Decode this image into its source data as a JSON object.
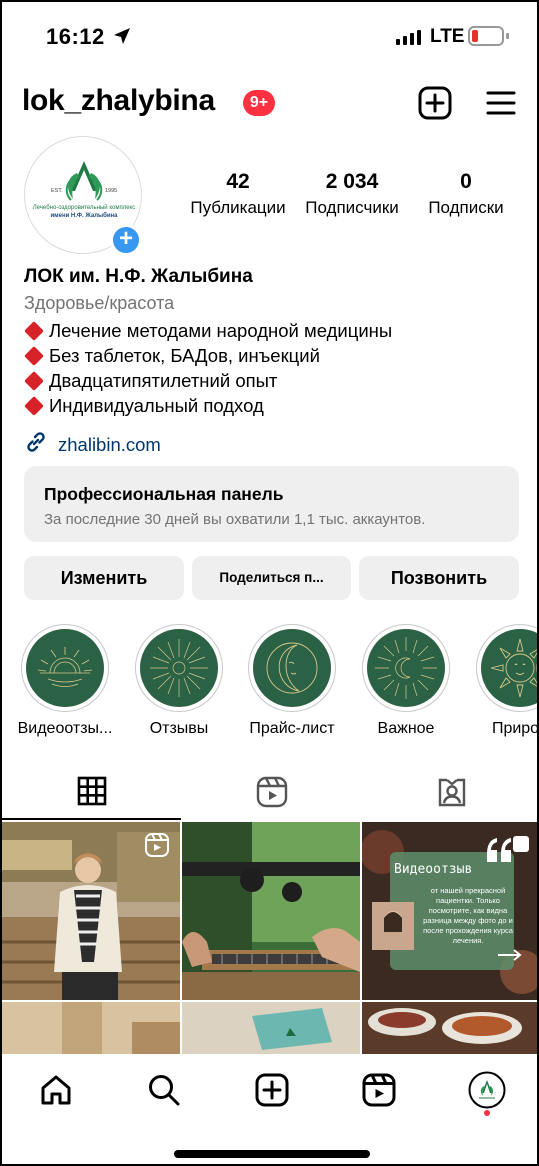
{
  "status_bar": {
    "time": "16:12",
    "network": "LTE",
    "location_icon": "location-arrow-icon",
    "signal_icon": "signal-bars-icon",
    "battery_icon": "battery-low-icon",
    "battery_level": 0.1,
    "battery_color": "#e5322d"
  },
  "header": {
    "username": "lok_zhalybina",
    "notification_badge": "9+",
    "badge_color": "#ff3040",
    "create_icon": "plus-square-icon",
    "menu_icon": "hamburger-menu-icon"
  },
  "profile": {
    "avatar": {
      "logo_icon": "lok-logo-icon",
      "logo_est": "EST.",
      "logo_year": "1995",
      "logo_line1": "Лечебно-оздоровительный комплекс",
      "logo_line2": "имени Н.Ф. Жалыбина",
      "add_story_icon": "plus-circle-icon"
    },
    "stats": [
      {
        "value": "42",
        "label": "Публикации"
      },
      {
        "value": "2 034",
        "label": "Подписчики"
      },
      {
        "value": "0",
        "label": "Подписки"
      }
    ],
    "name": "ЛОК им. Н.Ф. Жалыбина",
    "category": "Здоровье/красота",
    "bio_lines": [
      "Лечение методами народной медицины",
      "Без таблеток, БАДов, инъекций",
      "Двадцатипятилетний опыт",
      "Индивидуальный подход"
    ],
    "bio_bullet_icon": "red-diamond-icon",
    "link_icon": "link-icon",
    "link": "zhalibin.com",
    "link_color": "#00376b"
  },
  "professional_panel": {
    "title": "Профессиональная панель",
    "subtitle": "За последние 30 дней вы охватили 1,1 тыс. аккаунтов."
  },
  "actions": {
    "edit": "Изменить",
    "share": "Поделиться п...",
    "call": "Позвонить"
  },
  "highlights": [
    {
      "label": "Видеоотзы...",
      "icon": "sunrise-sun-icon"
    },
    {
      "label": "Отзывы",
      "icon": "sun-rays-icon"
    },
    {
      "label": "Прайс-лист",
      "icon": "moon-face-icon"
    },
    {
      "label": "Важное",
      "icon": "crescent-moon-icon"
    },
    {
      "label": "Природ",
      "icon": "sun-face-icon"
    }
  ],
  "highlight_color": "#2b6246",
  "tabs": [
    {
      "name": "grid",
      "icon": "grid-icon",
      "active": true
    },
    {
      "name": "reels",
      "icon": "reels-icon",
      "active": false
    },
    {
      "name": "tagged",
      "icon": "tagged-person-icon",
      "active": false
    }
  ],
  "grid_posts": [
    {
      "type": "reel",
      "description_icon": "reel-badge-icon"
    },
    {
      "type": "photo"
    },
    {
      "type": "carousel",
      "badge_icon": "carousel-badge-icon",
      "overlay_title": "Видеоотзыв",
      "overlay_text": "от нашей прекрасной пациентки. Только посмотрите, как видна разница между фото до и после прохождения курса лечения."
    },
    {
      "type": "photo"
    },
    {
      "type": "photo"
    },
    {
      "type": "photo"
    }
  ],
  "bottom_nav": [
    {
      "name": "home",
      "icon": "home-icon"
    },
    {
      "name": "search",
      "icon": "search-icon"
    },
    {
      "name": "create",
      "icon": "plus-square-icon"
    },
    {
      "name": "reels",
      "icon": "reels-icon"
    },
    {
      "name": "profile",
      "icon": "profile-avatar-icon"
    }
  ]
}
